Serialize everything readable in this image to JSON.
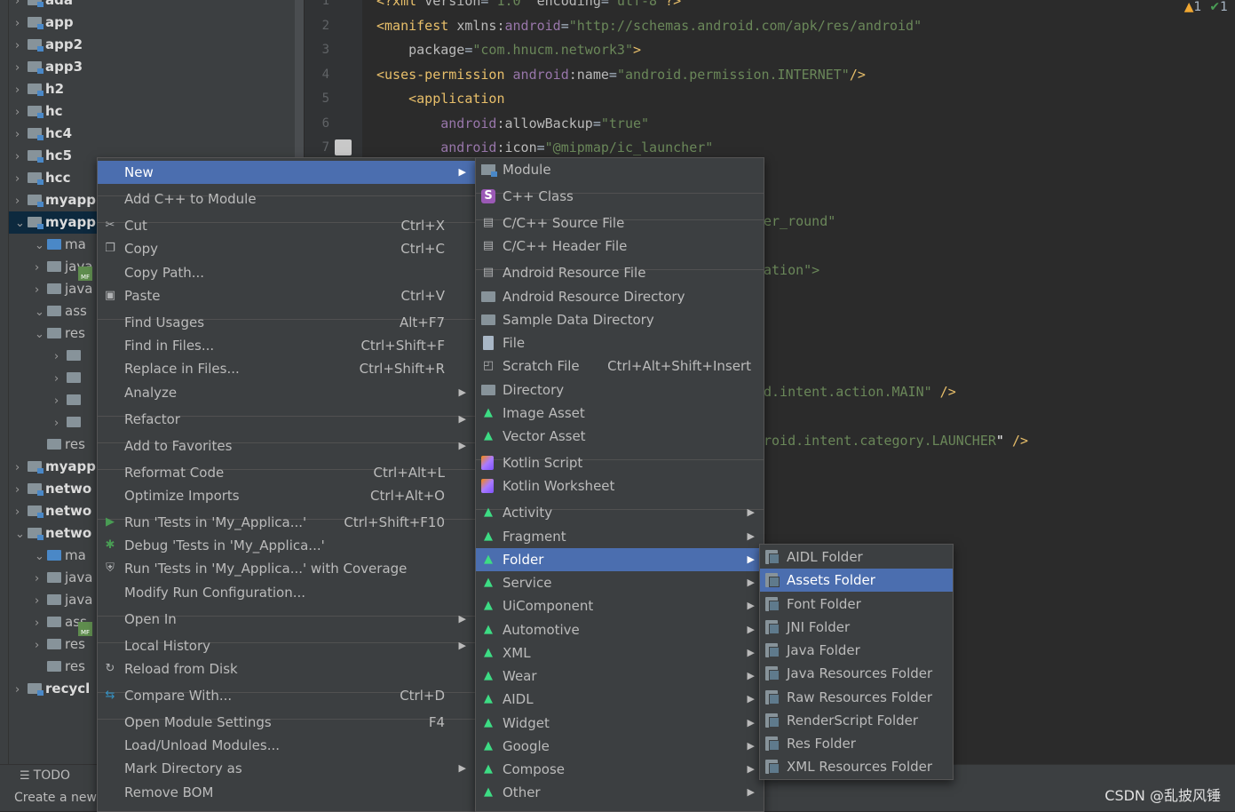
{
  "project_tree": [
    {
      "label": "ada",
      "chev": ">",
      "sub": false
    },
    {
      "label": "app",
      "chev": ">",
      "sub": false
    },
    {
      "label": "app2",
      "chev": ">",
      "sub": false
    },
    {
      "label": "app3",
      "chev": ">",
      "sub": false
    },
    {
      "label": "h2",
      "chev": ">",
      "sub": false
    },
    {
      "label": "hc",
      "chev": ">",
      "sub": false
    },
    {
      "label": "hc4",
      "chev": ">",
      "sub": false
    },
    {
      "label": "hc5",
      "chev": ">",
      "sub": false
    },
    {
      "label": "hcc",
      "chev": ">",
      "sub": false
    },
    {
      "label": "myapp",
      "chev": ">",
      "sub": false
    },
    {
      "label": "myapp",
      "chev": "∨",
      "sub": false,
      "selected": true
    },
    {
      "label": "ma",
      "chev": "∨",
      "sub": true
    },
    {
      "label": "java",
      "chev": ">",
      "sub": true
    },
    {
      "label": "java",
      "chev": ">",
      "sub": true
    },
    {
      "label": "ass",
      "chev": "∨",
      "sub": true
    },
    {
      "label": "res",
      "chev": "∨",
      "sub": true
    },
    {
      "label": "",
      "chev": ">",
      "sub": true
    },
    {
      "label": "",
      "chev": ">",
      "sub": true
    },
    {
      "label": "",
      "chev": ">",
      "sub": true
    },
    {
      "label": "",
      "chev": ">",
      "sub": true
    },
    {
      "label": "res",
      "chev": "",
      "sub": true
    },
    {
      "label": "myapp",
      "chev": ">",
      "sub": false
    },
    {
      "label": "netwo",
      "chev": ">",
      "sub": false
    },
    {
      "label": "netwo",
      "chev": ">",
      "sub": false
    },
    {
      "label": "netwo",
      "chev": "∨",
      "sub": false
    },
    {
      "label": "ma",
      "chev": "∨",
      "sub": true
    },
    {
      "label": "java",
      "chev": ">",
      "sub": true
    },
    {
      "label": "java",
      "chev": ">",
      "sub": true
    },
    {
      "label": "ass",
      "chev": ">",
      "sub": true
    },
    {
      "label": "res",
      "chev": ">",
      "sub": true
    },
    {
      "label": "res",
      "chev": "",
      "sub": true
    },
    {
      "label": "recycl",
      "chev": ">",
      "sub": false
    }
  ],
  "editor": {
    "line_numbers": [
      "1",
      "2",
      "3",
      "4",
      "5",
      "6",
      "7"
    ],
    "lines": [
      {
        "parts": [
          [
            "tag",
            "<?xml "
          ],
          [
            "attr",
            "version"
          ],
          [
            "eq",
            "="
          ],
          [
            "str",
            "\"1.0\" "
          ],
          [
            "attr",
            "encoding"
          ],
          [
            "eq",
            "="
          ],
          [
            "str",
            "\"utf-8\""
          ],
          [
            "tag",
            "?>"
          ]
        ]
      },
      {
        "parts": [
          [
            "tag",
            "<manifest "
          ],
          [
            "attr",
            "xmlns:"
          ],
          [
            "ns",
            "android"
          ],
          [
            "eq",
            "="
          ],
          [
            "str",
            "\"http://schemas.android.com/apk/res/android\""
          ]
        ]
      },
      {
        "parts": [
          [
            "attr",
            "    package"
          ],
          [
            "eq",
            "="
          ],
          [
            "str",
            "\"com.hnucm.network3\""
          ],
          [
            "tag",
            ">"
          ]
        ]
      },
      {
        "parts": [
          [
            "tag",
            "<uses-permission "
          ],
          [
            "ns",
            "android"
          ],
          [
            "attr",
            ":name"
          ],
          [
            "eq",
            "="
          ],
          [
            "str",
            "\"android.permission.INTERNET\""
          ],
          [
            "tag",
            "/>"
          ]
        ]
      },
      {
        "parts": [
          [
            "tag",
            "    <application"
          ]
        ]
      },
      {
        "parts": [
          [
            "ns",
            "        android"
          ],
          [
            "attr",
            ":allowBackup"
          ],
          [
            "eq",
            "="
          ],
          [
            "str",
            "\"true\""
          ]
        ]
      },
      {
        "parts": [
          [
            "ns",
            "        android"
          ],
          [
            "attr",
            ":icon"
          ],
          [
            "eq",
            "="
          ],
          [
            "str",
            "\"@mipmap/ic_launcher\""
          ]
        ]
      }
    ],
    "fragments": {
      "f1": "er_round\"",
      "f2": "ation\">",
      "f3a": "d.intent.action.MAIN\"",
      "f3b": " />",
      "f4a": "roid.intent.category.LAUNCHER",
      "f4b": "\"",
      "f4c": " />"
    },
    "inspection": {
      "warnings": "1",
      "ok": "1"
    }
  },
  "context_menu": {
    "items": [
      {
        "label": "New",
        "shortcut": "",
        "submenu": true,
        "icon": "",
        "highlighted": true
      },
      {
        "sep": true
      },
      {
        "label": "Add C++ to Module",
        "shortcut": "",
        "submenu": false,
        "icon": ""
      },
      {
        "sep": true
      },
      {
        "label": "Cut",
        "shortcut": "Ctrl+X",
        "submenu": false,
        "icon": "scissors-icon"
      },
      {
        "label": "Copy",
        "shortcut": "Ctrl+C",
        "submenu": false,
        "icon": "copy-icon"
      },
      {
        "label": "Copy Path...",
        "shortcut": "",
        "submenu": false,
        "icon": ""
      },
      {
        "label": "Paste",
        "shortcut": "Ctrl+V",
        "submenu": false,
        "icon": "paste-icon"
      },
      {
        "sep": true
      },
      {
        "label": "Find Usages",
        "shortcut": "Alt+F7",
        "submenu": false,
        "icon": ""
      },
      {
        "label": "Find in Files...",
        "shortcut": "Ctrl+Shift+F",
        "submenu": false,
        "icon": ""
      },
      {
        "label": "Replace in Files...",
        "shortcut": "Ctrl+Shift+R",
        "submenu": false,
        "icon": ""
      },
      {
        "label": "Analyze",
        "shortcut": "",
        "submenu": true,
        "icon": ""
      },
      {
        "sep": true
      },
      {
        "label": "Refactor",
        "shortcut": "",
        "submenu": true,
        "icon": ""
      },
      {
        "sep": true
      },
      {
        "label": "Add to Favorites",
        "shortcut": "",
        "submenu": true,
        "icon": ""
      },
      {
        "sep": true
      },
      {
        "label": "Reformat Code",
        "shortcut": "Ctrl+Alt+L",
        "submenu": false,
        "icon": ""
      },
      {
        "label": "Optimize Imports",
        "shortcut": "Ctrl+Alt+O",
        "submenu": false,
        "icon": ""
      },
      {
        "sep": true
      },
      {
        "label": "Run 'Tests in 'My_Applica...'",
        "shortcut": "Ctrl+Shift+F10",
        "submenu": false,
        "icon": "run-icon"
      },
      {
        "label": "Debug 'Tests in 'My_Applica...'",
        "shortcut": "",
        "submenu": false,
        "icon": "debug-icon"
      },
      {
        "label": "Run 'Tests in 'My_Applica...' with Coverage",
        "shortcut": "",
        "submenu": false,
        "icon": "coverage-icon"
      },
      {
        "label": "Modify Run Configuration...",
        "shortcut": "",
        "submenu": false,
        "icon": ""
      },
      {
        "sep": true
      },
      {
        "label": "Open In",
        "shortcut": "",
        "submenu": true,
        "icon": ""
      },
      {
        "sep": true
      },
      {
        "label": "Local History",
        "shortcut": "",
        "submenu": true,
        "icon": ""
      },
      {
        "label": "Reload from Disk",
        "shortcut": "",
        "submenu": false,
        "icon": "reload-icon"
      },
      {
        "sep": true
      },
      {
        "label": "Compare With...",
        "shortcut": "Ctrl+D",
        "submenu": false,
        "icon": "compare-icon"
      },
      {
        "sep": true
      },
      {
        "label": "Open Module Settings",
        "shortcut": "F4",
        "submenu": false,
        "icon": ""
      },
      {
        "label": "Load/Unload Modules...",
        "shortcut": "",
        "submenu": false,
        "icon": ""
      },
      {
        "label": "Mark Directory as",
        "shortcut": "",
        "submenu": true,
        "icon": ""
      },
      {
        "label": "Remove BOM",
        "shortcut": "",
        "submenu": false,
        "icon": ""
      }
    ]
  },
  "new_submenu": {
    "items": [
      {
        "label": "Module",
        "shortcut": "",
        "submenu": false,
        "icon": "module-icon"
      },
      {
        "sep": true
      },
      {
        "label": "C++ Class",
        "shortcut": "",
        "submenu": false,
        "icon": "cpp-class-icon"
      },
      {
        "sep": true
      },
      {
        "label": "C/C++ Source File",
        "shortcut": "",
        "submenu": false,
        "icon": "cpp-source-icon"
      },
      {
        "label": "C/C++ Header File",
        "shortcut": "",
        "submenu": false,
        "icon": "cpp-header-icon"
      },
      {
        "sep": true
      },
      {
        "label": "Android Resource File",
        "shortcut": "",
        "submenu": false,
        "icon": "resource-file-icon"
      },
      {
        "label": "Android Resource Directory",
        "shortcut": "",
        "submenu": false,
        "icon": "folder-icon"
      },
      {
        "label": "Sample Data Directory",
        "shortcut": "",
        "submenu": false,
        "icon": "folder-icon"
      },
      {
        "label": "File",
        "shortcut": "",
        "submenu": false,
        "icon": "file-icon"
      },
      {
        "label": "Scratch File",
        "shortcut": "Ctrl+Alt+Shift+Insert",
        "submenu": false,
        "icon": "scratch-file-icon"
      },
      {
        "label": "Directory",
        "shortcut": "",
        "submenu": false,
        "icon": "folder-icon"
      },
      {
        "label": "Image Asset",
        "shortcut": "",
        "submenu": false,
        "icon": "android-icon"
      },
      {
        "label": "Vector Asset",
        "shortcut": "",
        "submenu": false,
        "icon": "android-icon"
      },
      {
        "sep": true
      },
      {
        "label": "Kotlin Script",
        "shortcut": "",
        "submenu": false,
        "icon": "kotlin-icon"
      },
      {
        "label": "Kotlin Worksheet",
        "shortcut": "",
        "submenu": false,
        "icon": "kotlin-icon"
      },
      {
        "sep": true
      },
      {
        "label": "Activity",
        "shortcut": "",
        "submenu": true,
        "icon": "android-icon"
      },
      {
        "label": "Fragment",
        "shortcut": "",
        "submenu": true,
        "icon": "android-icon"
      },
      {
        "label": "Folder",
        "shortcut": "",
        "submenu": true,
        "icon": "android-icon",
        "highlighted": true
      },
      {
        "label": "Service",
        "shortcut": "",
        "submenu": true,
        "icon": "android-icon"
      },
      {
        "label": "UiComponent",
        "shortcut": "",
        "submenu": true,
        "icon": "android-icon"
      },
      {
        "label": "Automotive",
        "shortcut": "",
        "submenu": true,
        "icon": "android-icon"
      },
      {
        "label": "XML",
        "shortcut": "",
        "submenu": true,
        "icon": "android-icon"
      },
      {
        "label": "Wear",
        "shortcut": "",
        "submenu": true,
        "icon": "android-icon"
      },
      {
        "label": "AIDL",
        "shortcut": "",
        "submenu": true,
        "icon": "android-icon"
      },
      {
        "label": "Widget",
        "shortcut": "",
        "submenu": true,
        "icon": "android-icon"
      },
      {
        "label": "Google",
        "shortcut": "",
        "submenu": true,
        "icon": "android-icon"
      },
      {
        "label": "Compose",
        "shortcut": "",
        "submenu": true,
        "icon": "android-icon"
      },
      {
        "label": "Other",
        "shortcut": "",
        "submenu": true,
        "icon": "android-icon"
      }
    ]
  },
  "folder_submenu": {
    "items": [
      {
        "label": "AIDL Folder",
        "icon": "assets-folder-icon"
      },
      {
        "label": "Assets Folder",
        "icon": "assets-folder-icon",
        "highlighted": true
      },
      {
        "label": "Font Folder",
        "icon": "assets-folder-icon"
      },
      {
        "label": "JNI Folder",
        "icon": "assets-folder-icon"
      },
      {
        "label": "Java Folder",
        "icon": "assets-folder-icon"
      },
      {
        "label": "Java Resources Folder",
        "icon": "assets-folder-icon"
      },
      {
        "label": "Raw Resources Folder",
        "icon": "assets-folder-icon"
      },
      {
        "label": "RenderScript Folder",
        "icon": "assets-folder-icon"
      },
      {
        "label": "Res Folder",
        "icon": "assets-folder-icon"
      },
      {
        "label": "XML Resources Folder",
        "icon": "assets-folder-icon"
      }
    ]
  },
  "bottom": {
    "todo_label": "TODO",
    "status": "Create a new",
    "watermark": "CSDN @乱披风锤"
  },
  "colors": {
    "highlight": "#4b6eaf",
    "menu_bg": "#3c3f41",
    "editor_bg": "#2b2b2b",
    "tree_selected": "#0d293e"
  }
}
